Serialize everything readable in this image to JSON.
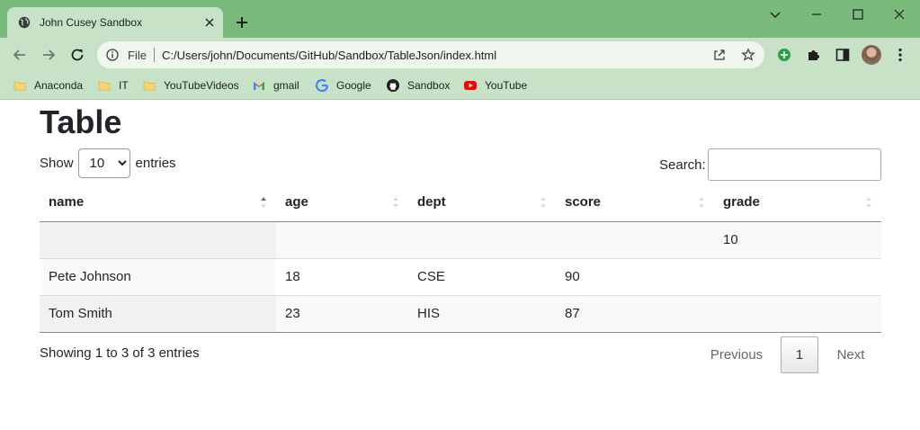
{
  "browser": {
    "tab_title": "John Cusey Sandbox",
    "omnibox_scheme": "File",
    "url": "C:/Users/john/Documents/GitHub/Sandbox/TableJson/index.html",
    "bookmarks": [
      {
        "label": "Anaconda",
        "icon": "folder-icon"
      },
      {
        "label": "IT",
        "icon": "folder-icon"
      },
      {
        "label": "YouTubeVideos",
        "icon": "folder-icon"
      },
      {
        "label": "gmail",
        "icon": "gmail-icon"
      },
      {
        "label": "Google",
        "icon": "google-icon"
      },
      {
        "label": "Sandbox",
        "icon": "github-icon"
      },
      {
        "label": "YouTube",
        "icon": "youtube-icon"
      }
    ]
  },
  "page": {
    "title": "Table",
    "length_label_before": "Show",
    "length_value": "10",
    "length_label_after": "entries",
    "search_label": "Search:",
    "columns": [
      "name",
      "age",
      "dept",
      "score",
      "grade"
    ],
    "rows": [
      {
        "name": "",
        "age": "",
        "dept": "",
        "score": "",
        "grade": "10"
      },
      {
        "name": "Pete Johnson",
        "age": "18",
        "dept": "CSE",
        "score": "90",
        "grade": ""
      },
      {
        "name": "Tom Smith",
        "age": "23",
        "dept": "HIS",
        "score": "87",
        "grade": ""
      }
    ],
    "info": "Showing 1 to 3 of 3 entries",
    "pagination": {
      "previous": "Previous",
      "current": "1",
      "next": "Next"
    }
  }
}
